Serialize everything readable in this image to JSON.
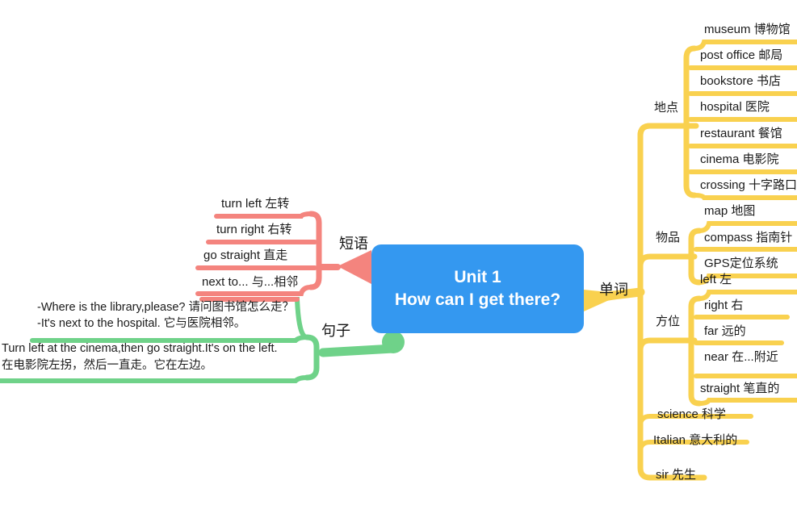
{
  "colors": {
    "center_fill": "#3498f0",
    "center_text": "#ffffff",
    "words_branch": "#f9d14f",
    "phrases_branch": "#f4847e",
    "sentences_branch": "#6fd289",
    "text": "#1a1a1a",
    "background": "#ffffff"
  },
  "center": {
    "title_line1": "Unit 1",
    "title_line2": "How can I get there?",
    "title_full": "Unit 1\nHow can I get there?"
  },
  "branches": {
    "words": {
      "label": "单词",
      "color": "#f9d14f",
      "groups": [
        {
          "label": "地点",
          "items": [
            {
              "en": "museum",
              "zh": "博物馆",
              "text": "museum 博物馆"
            },
            {
              "en": "post office",
              "zh": "邮局",
              "text": "post office 邮局"
            },
            {
              "en": "bookstore",
              "zh": "书店",
              "text": "bookstore 书店"
            },
            {
              "en": "hospital",
              "zh": "医院",
              "text": "hospital 医院"
            },
            {
              "en": "restaurant",
              "zh": "餐馆",
              "text": "restaurant 餐馆"
            },
            {
              "en": "cinema",
              "zh": "电影院",
              "text": "cinema 电影院"
            },
            {
              "en": "crossing",
              "zh": "十字路口",
              "text": "crossing 十字路口"
            }
          ]
        },
        {
          "label": "物品",
          "items": [
            {
              "en": "map",
              "zh": "地图",
              "text": "map 地图"
            },
            {
              "en": "compass",
              "zh": "指南针",
              "text": "compass 指南针"
            },
            {
              "en": "GPS",
              "zh": "定位系统",
              "text": "GPS定位系统"
            }
          ]
        },
        {
          "label": "方位",
          "items": [
            {
              "en": "left",
              "zh": "左",
              "text": "left 左"
            },
            {
              "en": "right",
              "zh": "右",
              "text": "right 右"
            },
            {
              "en": "far",
              "zh": "远的",
              "text": "far 远的"
            },
            {
              "en": "near",
              "zh": "在…附近",
              "text": "near 在...附近"
            },
            {
              "en": "straight",
              "zh": "笔直的",
              "text": "straight 笔直的"
            }
          ]
        }
      ],
      "loose_items": [
        {
          "en": "science",
          "zh": "科学",
          "text": "science 科学"
        },
        {
          "en": "Italian",
          "zh": "意大利的",
          "text": "Italian 意大利的"
        },
        {
          "en": "sir",
          "zh": "先生",
          "text": "sir 先生"
        }
      ]
    },
    "phrases": {
      "label": "短语",
      "color": "#f4847e",
      "items": [
        {
          "en": "turn left",
          "zh": "左转",
          "text": "turn left 左转"
        },
        {
          "en": "turn right",
          "zh": "右转",
          "text": "turn right 右转"
        },
        {
          "en": "go straight",
          "zh": "直走",
          "text": "go straight 直走"
        },
        {
          "en": "next to...",
          "zh": "与…相邻",
          "text": "next to... 与...相邻"
        }
      ]
    },
    "sentences": {
      "label": "句子",
      "color": "#6fd289",
      "items": [
        {
          "line1": "-Where is the library,please? 请问图书馆怎么走？",
          "line2": "-It's next to the hospital. 它与医院相邻。"
        },
        {
          "line1": "Turn left at the cinema,then go straight.It's on the left.",
          "line2": "在电影院左拐，然后一直走。它在左边。"
        }
      ]
    }
  }
}
